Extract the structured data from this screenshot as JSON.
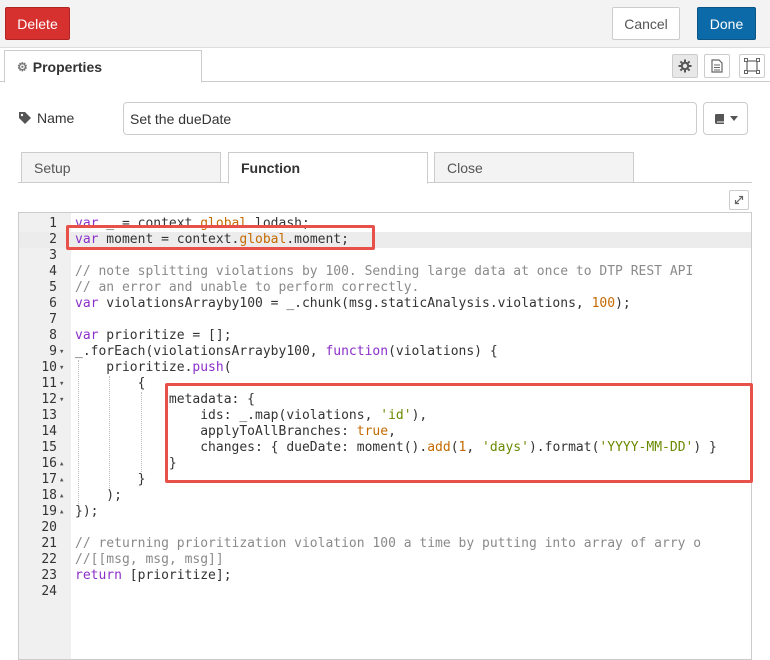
{
  "toolbar": {
    "delete_label": "Delete",
    "cancel_label": "Cancel",
    "done_label": "Done"
  },
  "tabs": {
    "properties_label": "Properties"
  },
  "name_field": {
    "label": "Name",
    "value": "Set the dueDate"
  },
  "subtabs": [
    "Setup",
    "Function",
    "Close"
  ],
  "active_subtab": "Function",
  "colors": {
    "delete": "#d6302f",
    "done": "#0d6aa8",
    "highlight": "#e8504a"
  },
  "editor": {
    "active_line": 2,
    "lines": [
      {
        "n": "1",
        "fold": "",
        "text": "var _ = context.global.lodash;"
      },
      {
        "n": "2",
        "fold": "",
        "text": "var moment = context.global.moment;"
      },
      {
        "n": "3",
        "fold": "",
        "text": ""
      },
      {
        "n": "4",
        "fold": "",
        "text": "// note splitting violations by 100. Sending large data at once to DTP REST API"
      },
      {
        "n": "5",
        "fold": "",
        "text": "// an error and unable to perform correctly."
      },
      {
        "n": "6",
        "fold": "",
        "text": "var violationsArrayby100 = _.chunk(msg.staticAnalysis.violations, 100);"
      },
      {
        "n": "7",
        "fold": "",
        "text": ""
      },
      {
        "n": "8",
        "fold": "",
        "text": "var prioritize = [];"
      },
      {
        "n": "9",
        "fold": "▾",
        "text": "_.forEach(violationsArrayby100, function(violations) {"
      },
      {
        "n": "10",
        "fold": "▾",
        "text": "    prioritize.push("
      },
      {
        "n": "11",
        "fold": "▾",
        "text": "        {"
      },
      {
        "n": "12",
        "fold": "▾",
        "text": "            metadata: {"
      },
      {
        "n": "13",
        "fold": "",
        "text": "                ids: _.map(violations, 'id'),"
      },
      {
        "n": "14",
        "fold": "",
        "text": "                applyToAllBranches: true,"
      },
      {
        "n": "15",
        "fold": "",
        "text": "                changes: { dueDate: moment().add(1, 'days').format('YYYY-MM-DD') }"
      },
      {
        "n": "16",
        "fold": "▴",
        "text": "            }"
      },
      {
        "n": "17",
        "fold": "▴",
        "text": "        }"
      },
      {
        "n": "18",
        "fold": "▴",
        "text": "    );"
      },
      {
        "n": "19",
        "fold": "▴",
        "text": "});"
      },
      {
        "n": "20",
        "fold": "",
        "text": ""
      },
      {
        "n": "21",
        "fold": "",
        "text": "// returning prioritization violation 100 a time by putting into array of arry o"
      },
      {
        "n": "22",
        "fold": "",
        "text": "//[[msg, msg, msg]]"
      },
      {
        "n": "23",
        "fold": "",
        "text": "return [prioritize];"
      },
      {
        "n": "24",
        "fold": "",
        "text": ""
      }
    ]
  },
  "icons": {
    "properties_tab": "gear-icon",
    "side_buttons": [
      "gear-icon",
      "document-icon",
      "frame-icon"
    ],
    "name_label": "tag-icon",
    "name_dropdown": "book-icon",
    "expand": "expand-icon"
  }
}
